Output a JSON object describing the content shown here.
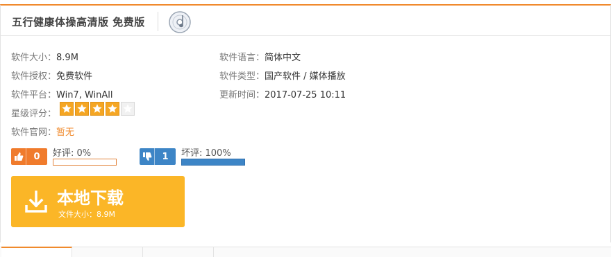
{
  "title": "五行健康体操高清版 免费版",
  "info": {
    "size_label": "软件大小：",
    "size_value": "8.9M",
    "language_label": "软件语言：",
    "language_value": "简体中文",
    "license_label": "软件授权：",
    "license_value": "免费软件",
    "type_label": "软件类型：",
    "type_value": "国产软件 / 媒体播放",
    "platform_label": "软件平台：",
    "platform_value": "Win7, WinAll",
    "updated_label": "更新时间：",
    "updated_value": "2017-07-25 10:11",
    "rating_label": "星级评分：",
    "rating_value": 4,
    "rating_max": 5,
    "website_label": "软件官网：",
    "website_value": "暂无"
  },
  "votes": {
    "good_count": "0",
    "good_label": "好评: 0%",
    "good_fraction": 0,
    "bad_count": "1",
    "bad_label": "坏评: 100%",
    "bad_fraction": 1
  },
  "download": {
    "title": "本地下载",
    "size_text": "文件大小：8.9M"
  },
  "colors": {
    "accent": "#f08a2c",
    "download_bg": "#fbb627",
    "good": "#f07b2c",
    "bad": "#3d85c6"
  },
  "icons": {
    "app": "cd-disc-icon",
    "good": "thumbs-up-icon",
    "bad": "thumbs-down-icon",
    "download": "download-icon"
  }
}
